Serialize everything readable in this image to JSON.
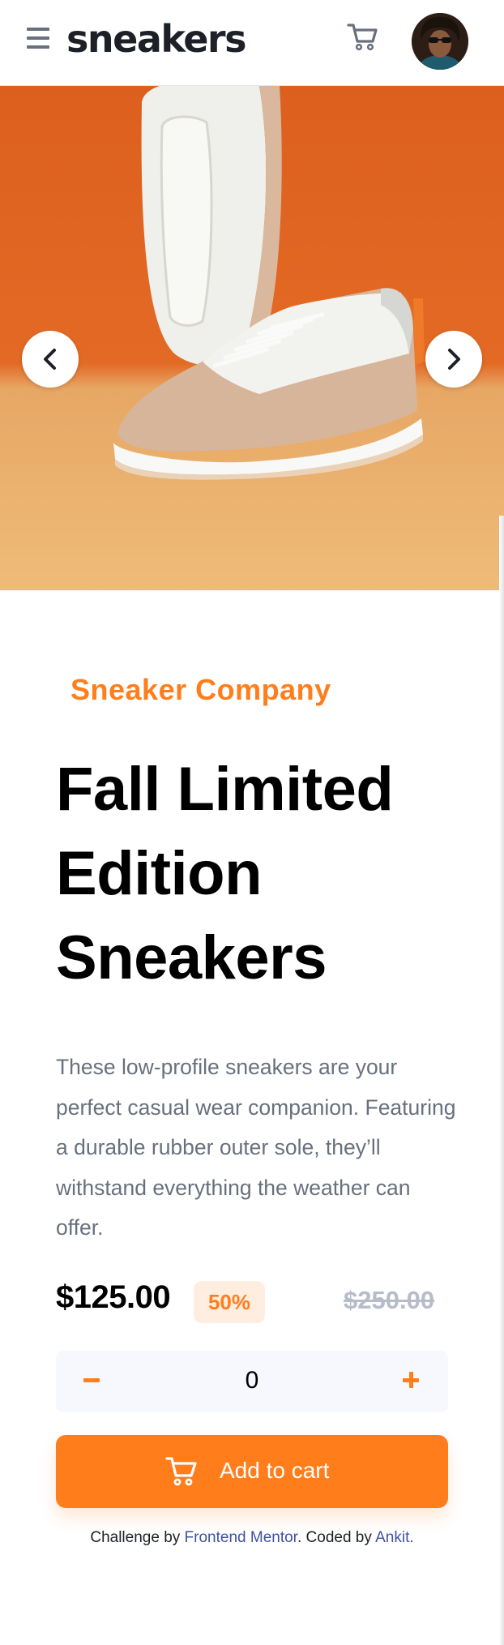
{
  "header": {
    "logo": "sneakers",
    "menu_icon": "hamburger-menu-icon",
    "cart_icon": "cart-icon",
    "avatar_icon": "user-avatar"
  },
  "gallery": {
    "prev_icon": "chevron-left-icon",
    "next_icon": "chevron-right-icon"
  },
  "product": {
    "company": "Sneaker Company",
    "title": "Fall Limited Edition Sneakers",
    "description": "These low-profile sneakers are your perfect casual wear companion. Featuring a durable rubber outer sole, they’ll withstand everything the weather can offer.",
    "price": "$125.00",
    "discount": "50%",
    "original_price": "$250.00"
  },
  "quantity": {
    "value": "0",
    "minus_icon": "minus-icon",
    "plus_icon": "plus-icon"
  },
  "add_to_cart": {
    "label": "Add to cart",
    "icon": "cart-icon"
  },
  "attribution": {
    "prefix": "Challenge by",
    "frontend_mentor": "Frontend Mentor",
    "middle": ". Coded by",
    "author": "Ankit",
    "suffix": "."
  },
  "colors": {
    "accent": "#ff7e1b",
    "accent_light": "#ffede0",
    "text_dark": "#1d2026",
    "text_muted": "#69707d",
    "strike": "#b6bcc8",
    "link": "#3e52a3"
  }
}
